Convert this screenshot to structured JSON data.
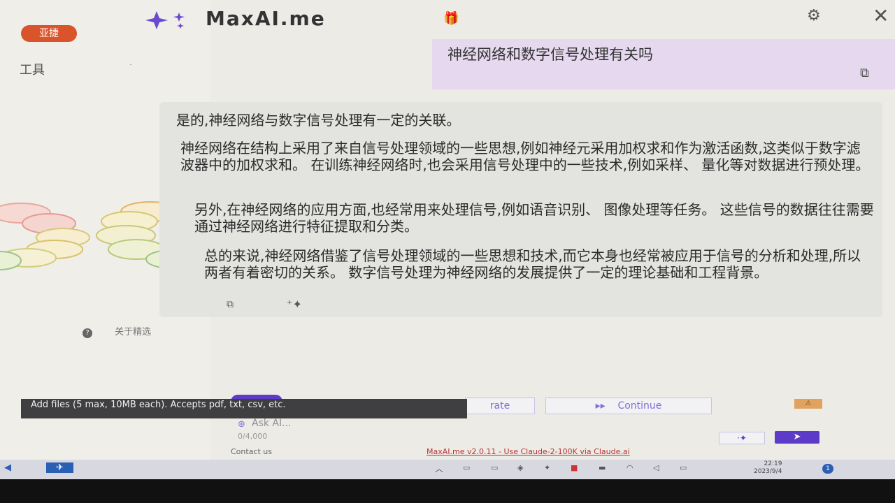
{
  "background_page": {
    "badge": "亚捷",
    "tools_label": "工具",
    "about_label": "关于精选",
    "about_icon": "?"
  },
  "header": {
    "brand": "MaxAI.me",
    "logo_icon": "sparkle-icon",
    "gift_icon": "gift-icon",
    "settings_icon": "gear-icon",
    "close_icon": "close-icon"
  },
  "conversation": {
    "user_message": "神经网络和数字信号处理有关吗",
    "ai_paragraphs": [
      "是的,神经网络与数字信号处理有一定的关联。",
      "神经网络在结构上采用了来自信号处理领域的一些思想,例如神经元采用加权求和作为激活函数,这类似于数字滤波器中的加权求和。 在训练神经网络时,也会采用信号处理中的一些技术,例如采样、 量化等对数据进行预处理。",
      "另外,在神经网络的应用方面,也经常用来处理信号,例如语音识别、 图像处理等任务。 这些信号的数据往往需要通过神经网络进行特征提取和分类。",
      "总的来说,神经网络借鉴了信号处理领域的一些思想和技术,而它本身也经常被应用于信号的分析和处理,所以两者有着密切的关系。 数字信号处理为神经网络的发展提供了一定的理论基础和工程背景。"
    ]
  },
  "controls": {
    "regenerate_label": "rate",
    "continue_label": "Continue",
    "continue_icon": "▸▸",
    "tooltip": "Add files (5 max, 10MB each). Accepts pdf, txt, csv, etc.",
    "ask_placeholder": "Ask AI...",
    "counter": "0/4,000",
    "prompt_icon": "·✦",
    "send_icon": "➤",
    "contact": "Contact us",
    "footer_link": "MaxAI.me v2.0.11 - Use Claude-2-100K via Claude.ai"
  },
  "taskbar": {
    "time": "22:19",
    "date": "2023/9/4",
    "notifications": "1"
  },
  "colors": {
    "accent": "#5b3bc7",
    "user_bubble": "#e6d9ef",
    "ai_bubble": "#e3e3e0"
  }
}
